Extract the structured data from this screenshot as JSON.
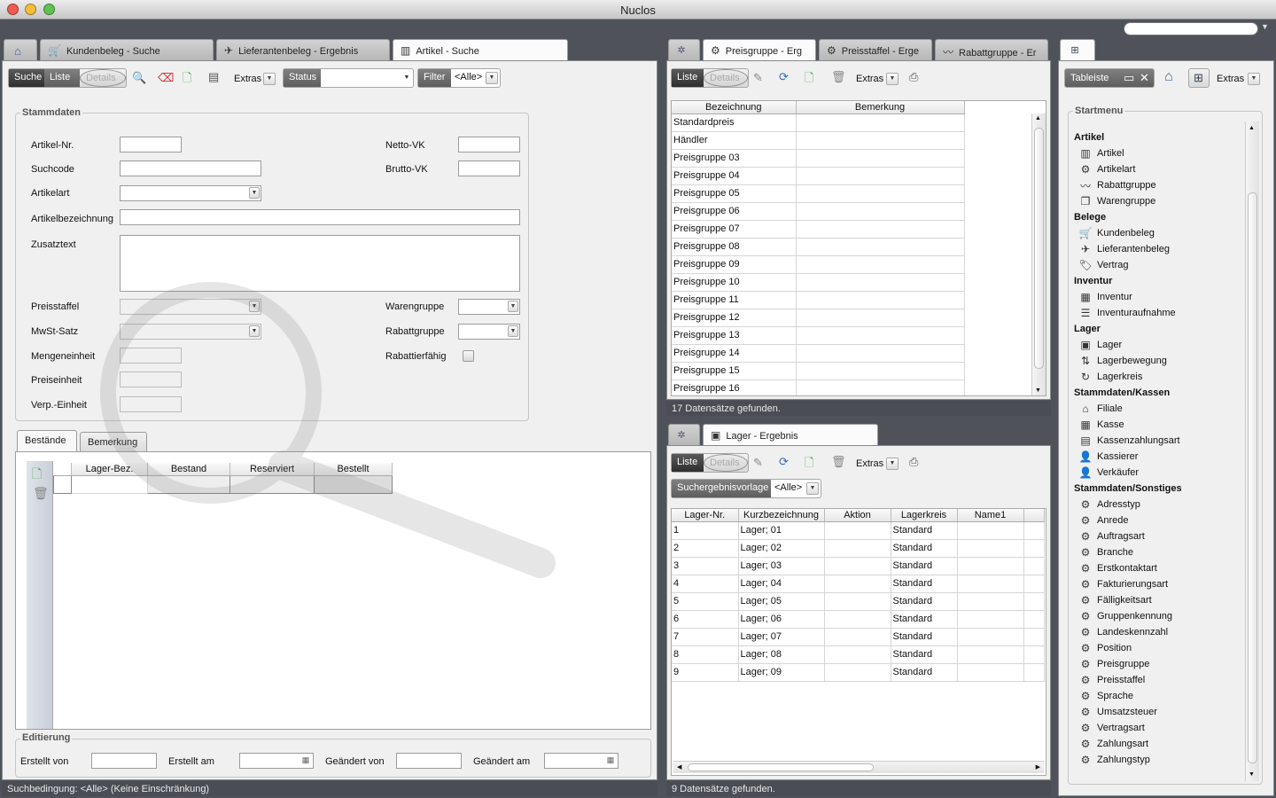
{
  "window": {
    "title": "Nuclos"
  },
  "left_tabs": [
    {
      "label": "Kundenbeleg - Suche",
      "icon": "cart-icon"
    },
    {
      "label": "Lieferantenbeleg - Ergebnis",
      "icon": "plane-icon"
    },
    {
      "label": "Artikel - Suche",
      "icon": "barcode-icon"
    }
  ],
  "left_toolbar": {
    "suche": "Suche",
    "liste": "Liste",
    "details": "Details",
    "extras": "Extras",
    "status": "Status",
    "filter": "Filter",
    "filter_value": "<Alle>"
  },
  "stammdaten": {
    "title": "Stammdaten",
    "fields": {
      "artikel_nr": "Artikel-Nr.",
      "suchcode": "Suchcode",
      "artikelart": "Artikelart",
      "artikelbezeichnung": "Artikelbezeichnung",
      "zusatztext": "Zusatztext",
      "preisstaffel": "Preisstaffel",
      "mwst": "MwSt-Satz",
      "mengeneinheit": "Mengeneinheit",
      "preiseinheit": "Preiseinheit",
      "verp": "Verp.-Einheit",
      "netto_vk": "Netto-VK",
      "brutto_vk": "Brutto-VK",
      "warengruppe": "Warengruppe",
      "rabattgruppe": "Rabattgruppe",
      "rabattierfaehig": "Rabattierfähig"
    }
  },
  "subtabs": [
    "Bestände",
    "Bemerkung"
  ],
  "bestaende": {
    "columns": [
      "Lager-Bez.",
      "Bestand",
      "Reserviert",
      "Bestellt"
    ]
  },
  "editierung": {
    "title": "Editierung",
    "erstellt_von": "Erstellt von",
    "erstellt_am": "Erstellt am",
    "geaendert_von": "Geändert von",
    "geaendert_am": "Geändert am"
  },
  "left_status": "Suchbedingung: <Alle> (Keine Einschränkung)",
  "preis_tabs": [
    {
      "label": "Preisgruppe - Erg"
    },
    {
      "label": "Preisstaffel - Erge"
    },
    {
      "label": "Rabattgruppe - Er"
    }
  ],
  "preis_toolbar": {
    "liste": "Liste",
    "details": "Details",
    "extras": "Extras"
  },
  "preis_table": {
    "columns": [
      "Bezeichnung",
      "Bemerkung"
    ],
    "rows": [
      "Standardpreis",
      "Händler",
      "Preisgruppe 03",
      "Preisgruppe 04",
      "Preisgruppe 05",
      "Preisgruppe 06",
      "Preisgruppe 07",
      "Preisgruppe 08",
      "Preisgruppe 09",
      "Preisgruppe 10",
      "Preisgruppe 11",
      "Preisgruppe 12",
      "Preisgruppe 13",
      "Preisgruppe 14",
      "Preisgruppe 15",
      "Preisgruppe 16"
    ]
  },
  "preis_status": "17 Datensätze gefunden.",
  "lager_tab": {
    "label": "Lager - Ergebnis"
  },
  "lager_toolbar": {
    "liste": "Liste",
    "details": "Details",
    "extras": "Extras",
    "vorlage": "Suchergebnisvorlage",
    "vorlage_value": "<Alle>"
  },
  "lager_table": {
    "columns": [
      "Lager-Nr.",
      "Kurzbezeichnung",
      "Aktion",
      "Lagerkreis",
      "Name1"
    ],
    "rows": [
      [
        "1",
        "Lager; 01",
        "",
        "Standard",
        ""
      ],
      [
        "2",
        "Lager; 02",
        "",
        "Standard",
        ""
      ],
      [
        "3",
        "Lager; 03",
        "",
        "Standard",
        ""
      ],
      [
        "4",
        "Lager; 04",
        "",
        "Standard",
        ""
      ],
      [
        "5",
        "Lager; 05",
        "",
        "Standard",
        ""
      ],
      [
        "6",
        "Lager; 06",
        "",
        "Standard",
        ""
      ],
      [
        "7",
        "Lager; 07",
        "",
        "Standard",
        ""
      ],
      [
        "8",
        "Lager; 08",
        "",
        "Standard",
        ""
      ],
      [
        "9",
        "Lager; 09",
        "",
        "Standard",
        ""
      ]
    ]
  },
  "lager_status": "9 Datensätze gefunden.",
  "right_toolbar": {
    "tableiste": "Tableiste",
    "extras": "Extras"
  },
  "startmenu": {
    "title": "Startmenu",
    "groups": [
      {
        "name": "Artikel",
        "items": [
          {
            "label": "Artikel",
            "icon": "barcode-icon",
            "glyph": "▥"
          },
          {
            "label": "Artikelart",
            "icon": "gear-icon",
            "glyph": "⚙"
          },
          {
            "label": "Rabattgruppe",
            "icon": "chart-icon",
            "glyph": "〰"
          },
          {
            "label": "Warengruppe",
            "icon": "window-icon",
            "glyph": "❐"
          }
        ]
      },
      {
        "name": "Belege",
        "items": [
          {
            "label": "Kundenbeleg",
            "icon": "cart-icon",
            "glyph": "🛒"
          },
          {
            "label": "Lieferantenbeleg",
            "icon": "plane-icon",
            "glyph": "✈"
          },
          {
            "label": "Vertrag",
            "icon": "tag-icon",
            "glyph": "🏷"
          }
        ]
      },
      {
        "name": "Inventur",
        "items": [
          {
            "label": "Inventur",
            "icon": "calendar-icon",
            "glyph": "▦"
          },
          {
            "label": "Inventuraufnahme",
            "icon": "list-icon",
            "glyph": "☰"
          }
        ]
      },
      {
        "name": "Lager",
        "items": [
          {
            "label": "Lager",
            "icon": "box-icon",
            "glyph": "▣"
          },
          {
            "label": "Lagerbewegung",
            "icon": "move-icon",
            "glyph": "⇅"
          },
          {
            "label": "Lagerkreis",
            "icon": "cycle-icon",
            "glyph": "↻"
          }
        ]
      },
      {
        "name": "Stammdaten/Kassen",
        "items": [
          {
            "label": "Filiale",
            "icon": "house-icon",
            "glyph": "⌂"
          },
          {
            "label": "Kasse",
            "icon": "calculator-icon",
            "glyph": "▦"
          },
          {
            "label": "Kassenzahlungsart",
            "icon": "table-icon",
            "glyph": "▤"
          },
          {
            "label": "Kassierer",
            "icon": "person-icon",
            "glyph": "👤"
          },
          {
            "label": "Verkäufer",
            "icon": "person-icon",
            "glyph": "👤"
          }
        ]
      },
      {
        "name": "Stammdaten/Sonstiges",
        "items": [
          {
            "label": "Adresstyp",
            "icon": "gear-icon",
            "glyph": "⚙"
          },
          {
            "label": "Anrede",
            "icon": "gear-icon",
            "glyph": "⚙"
          },
          {
            "label": "Auftragsart",
            "icon": "gear-icon",
            "glyph": "⚙"
          },
          {
            "label": "Branche",
            "icon": "gear-icon",
            "glyph": "⚙"
          },
          {
            "label": "Erstkontaktart",
            "icon": "gear-icon",
            "glyph": "⚙"
          },
          {
            "label": "Fakturierungsart",
            "icon": "gear-icon",
            "glyph": "⚙"
          },
          {
            "label": "Fälligkeitsart",
            "icon": "gear-icon",
            "glyph": "⚙"
          },
          {
            "label": "Gruppenkennung",
            "icon": "gear-icon",
            "glyph": "⚙"
          },
          {
            "label": "Landeskennzahl",
            "icon": "gear-icon",
            "glyph": "⚙"
          },
          {
            "label": "Position",
            "icon": "gear-icon",
            "glyph": "⚙"
          },
          {
            "label": "Preisgruppe",
            "icon": "gear-icon",
            "glyph": "⚙"
          },
          {
            "label": "Preisstaffel",
            "icon": "gear-icon",
            "glyph": "⚙"
          },
          {
            "label": "Sprache",
            "icon": "gear-icon",
            "glyph": "⚙"
          },
          {
            "label": "Umsatzsteuer",
            "icon": "gear-icon",
            "glyph": "⚙"
          },
          {
            "label": "Vertragsart",
            "icon": "gear-icon",
            "glyph": "⚙"
          },
          {
            "label": "Zahlungsart",
            "icon": "gear-icon",
            "glyph": "⚙"
          },
          {
            "label": "Zahlungstyp",
            "icon": "gear-icon",
            "glyph": "⚙"
          }
        ]
      }
    ]
  }
}
